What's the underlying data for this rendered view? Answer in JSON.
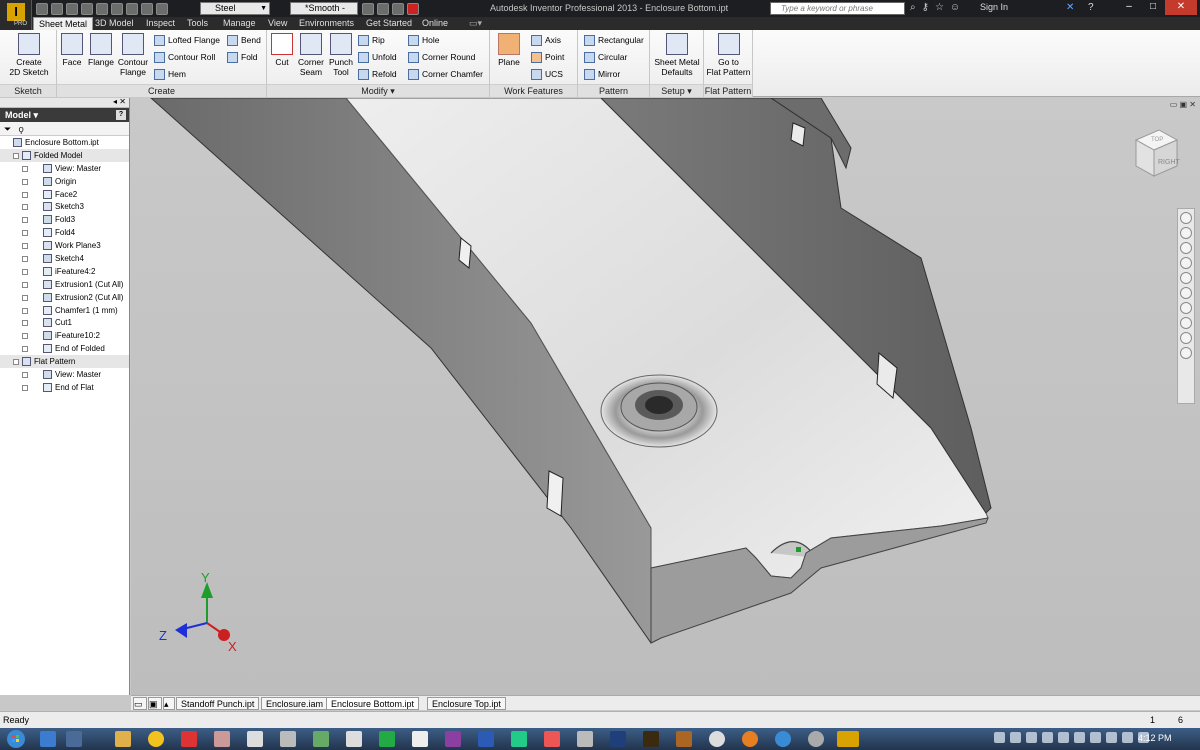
{
  "app": {
    "title": "Autodesk Inventor Professional 2013 - Enclosure Bottom.ipt",
    "logo": "I",
    "edition": "PRO"
  },
  "qat": {
    "material": "Steel",
    "appearance": "*Smooth -",
    "search_placeholder": "Type a keyword or phrase",
    "signin": "Sign In"
  },
  "ribbon_tabs": [
    "Sheet Metal",
    "3D Model",
    "Inspect",
    "Tools",
    "Manage",
    "View",
    "Environments",
    "Get Started",
    "Online"
  ],
  "panels": {
    "sketch": {
      "title": "Sketch",
      "create_2d_sketch": "Create\n2D Sketch"
    },
    "create": {
      "title": "Create",
      "face": "Face",
      "flange": "Flange",
      "contour_flange": "Contour\nFlange",
      "lofted_flange": "Lofted Flange",
      "contour_roll": "Contour Roll",
      "hem": "Hem",
      "bend": "Bend",
      "fold": "Fold"
    },
    "modify": {
      "title": "Modify ▾",
      "cut": "Cut",
      "corner_seam": "Corner\nSeam",
      "punch_tool": "Punch\nTool",
      "rip": "Rip",
      "unfold": "Unfold",
      "refold": "Refold",
      "hole": "Hole",
      "corner_round": "Corner Round",
      "corner_chamfer": "Corner Chamfer"
    },
    "work_features": {
      "title": "Work Features",
      "plane": "Plane",
      "axis": "Axis",
      "point": "Point",
      "ucs": "UCS"
    },
    "pattern": {
      "title": "Pattern",
      "rectangular": "Rectangular",
      "circular": "Circular",
      "mirror": "Mirror"
    },
    "setup": {
      "title": "Setup ▾",
      "sheet_metal_defaults": "Sheet Metal\nDefaults"
    },
    "flat_pattern": {
      "title": "Flat Pattern",
      "go_to_flat_pattern": "Go to\nFlat Pattern"
    }
  },
  "browser": {
    "title": "Model ▾",
    "items": [
      {
        "label": "Enclosure Bottom.ipt",
        "level": 0
      },
      {
        "label": "Folded Model",
        "level": 1
      },
      {
        "label": "View: Master",
        "level": 2
      },
      {
        "label": "Origin",
        "level": 2
      },
      {
        "label": "Face2",
        "level": 2
      },
      {
        "label": "Sketch3",
        "level": 2
      },
      {
        "label": "Fold3",
        "level": 2
      },
      {
        "label": "Fold4",
        "level": 2
      },
      {
        "label": "Work Plane3",
        "level": 2
      },
      {
        "label": "Sketch4",
        "level": 2
      },
      {
        "label": "iFeature4:2",
        "level": 2
      },
      {
        "label": "Extrusion1 (Cut All)",
        "level": 2
      },
      {
        "label": "Extrusion2 (Cut All)",
        "level": 2
      },
      {
        "label": "Chamfer1 (1 mm)",
        "level": 2
      },
      {
        "label": "Cut1",
        "level": 2
      },
      {
        "label": "iFeature10:2",
        "level": 2
      },
      {
        "label": "End of Folded",
        "level": 2
      },
      {
        "label": "Flat Pattern",
        "level": 1
      },
      {
        "label": "View: Master",
        "level": 2
      },
      {
        "label": "End of Flat",
        "level": 2
      }
    ]
  },
  "viewcube": {
    "face": "RIGHT",
    "face_top": "TOP"
  },
  "triad": {
    "x": "X",
    "y": "Y",
    "z": "Z"
  },
  "doc_tabs": [
    "Standoff Punch.ipt",
    "Enclosure.iam",
    "Enclosure Bottom.ipt",
    "Enclosure Top.ipt"
  ],
  "status": {
    "text": "Ready",
    "n1": "1",
    "n2": "6"
  },
  "clock": "4:12 PM",
  "colors": {
    "ribbon_dark": "#2b2b2b",
    "x_axis": "#cc1f1f",
    "y_axis": "#1f9d2b",
    "z_axis": "#1c2fd8"
  }
}
